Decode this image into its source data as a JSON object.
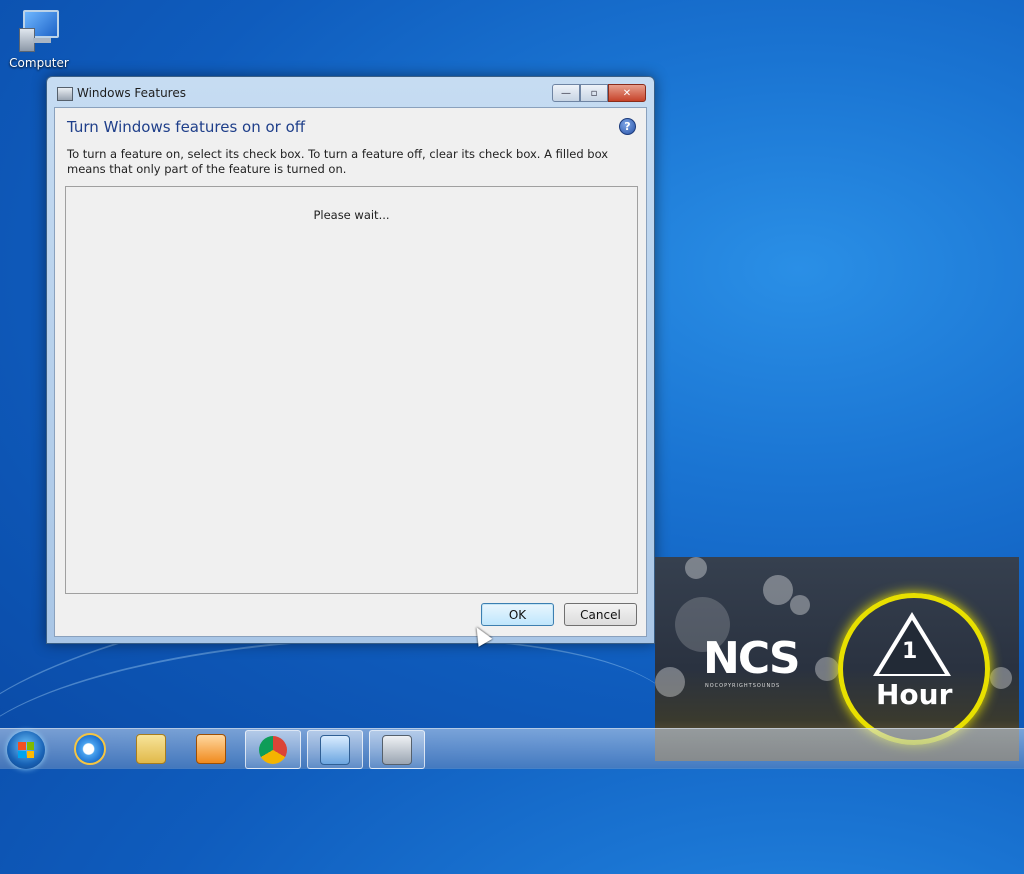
{
  "desktop": {
    "icons": [
      {
        "label": "Computer"
      }
    ]
  },
  "window": {
    "title": "Windows Features",
    "heading": "Turn Windows features on or off",
    "description": "To turn a feature on, select its check box. To turn a feature off, clear its check box. A filled box means that only part of the feature is turned on.",
    "status": "Please wait...",
    "buttons": {
      "ok": "OK",
      "cancel": "Cancel"
    },
    "help_glyph": "?",
    "caption": {
      "minimize": "—",
      "maximize": "▫",
      "close": "✕"
    }
  },
  "overlay": {
    "logo": "NCS",
    "subtitle": "NOCOPYRIGHTSOUNDS",
    "badge_number": "1",
    "badge_text": "Hour",
    "accent": "#e8e000"
  },
  "taskbar": {
    "items": [
      "start-orb",
      "internet-explorer-icon",
      "file-explorer-icon",
      "media-player-icon",
      "chrome-icon",
      "control-panel-icon",
      "windows-features-icon"
    ]
  },
  "colors": {
    "heading": "#1f3f8a",
    "desktop": "#1a74d2"
  }
}
